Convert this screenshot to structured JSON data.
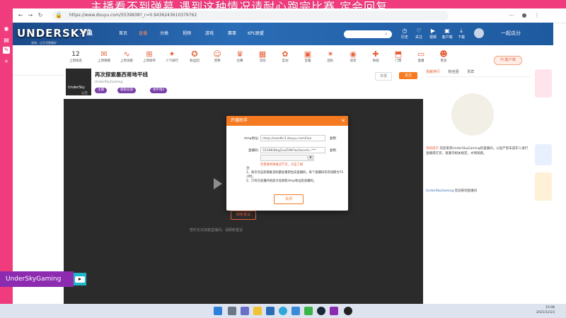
{
  "banner": {
    "text": "主播看不到弹幕  遇到这种情况请耐心跑完比赛 定会回复"
  },
  "browser": {
    "url": "https://www.douyu.com/5539838?_r=0.9436243610379762"
  },
  "overlay": {
    "logo": "UNDERSKY",
    "logo_sub": "游戏，让生活更美好",
    "channel_name": "UnderSkyGaming"
  },
  "site": {
    "logo": "斗鱼",
    "nav": [
      "首页",
      "直播",
      "分类",
      "视频",
      "游戏",
      "赛事",
      "KPL联盟"
    ],
    "search_placeholder": "",
    "header_icons": [
      {
        "icon": "history-icon",
        "label": "历史"
      },
      {
        "icon": "follow-icon",
        "label": "关注"
      },
      {
        "icon": "video-icon",
        "label": "视频"
      },
      {
        "icon": "live-icon",
        "label": "客户端"
      },
      {
        "icon": "download-icon",
        "label": "下载"
      },
      {
        "icon": "user-icon",
        "label": "我的"
      }
    ],
    "banner_right": "一起瓜分"
  },
  "categories": [
    {
      "icon": "level-icon",
      "label": "上周排名",
      "top": "12"
    },
    {
      "icon": "gift-icon",
      "label": "上周捐赠"
    },
    {
      "icon": "wave-icon",
      "label": "上周贡献"
    },
    {
      "icon": "rank-icon",
      "label": "上周榜单"
    },
    {
      "icon": "hot-icon",
      "label": "人气排行"
    },
    {
      "icon": "star-icon",
      "label": "粉丝团"
    },
    {
      "icon": "pet-icon",
      "label": "宠物"
    },
    {
      "icon": "cup-icon",
      "label": "比赛"
    },
    {
      "icon": "calendar-icon",
      "label": "活动"
    },
    {
      "icon": "chat-icon",
      "label": "互动"
    },
    {
      "icon": "box-icon",
      "label": "宝箱"
    },
    {
      "icon": "team-icon",
      "label": "团队"
    },
    {
      "icon": "mic-icon",
      "label": "语音"
    },
    {
      "icon": "shop-icon",
      "label": "商城"
    },
    {
      "icon": "ticket-icon",
      "label": "门票"
    },
    {
      "icon": "tv-icon",
      "label": "直播"
    },
    {
      "icon": "smile-icon",
      "label": "更多"
    }
  ],
  "pc_button": "PC客户端",
  "room": {
    "title": "再次探索墨西哥地平线",
    "streamer": "UnderSkyGaming",
    "avatar_text": "UnderSky",
    "avatar_sub": "公告",
    "tags": [
      "主播",
      "极限竞速",
      "地平线5"
    ],
    "follow_label": "关注",
    "report_label": "举报"
  },
  "video": {
    "message": "暂时无法加载直播间，请刷新重试",
    "button": "刷新重试"
  },
  "modal": {
    "title": "开播助手",
    "rtmp_label": "rtmp地址:",
    "rtmp_value": "rtmp://sendtc3.douyu.com/live",
    "code_label": "直播码:",
    "code_value": "5539838rgZuzZVN?wsSecret=***",
    "copy_label": "复制",
    "select_value": "",
    "warning": "若需要更换推流节点，点击了解",
    "note_title": "注:",
    "notes": [
      "1、每次点击获取推流码都会重新生成直播码，每个直播码仅有效期为72小时。",
      "2、只有在直播开始前才会获取rtmp地址及直播码。"
    ],
    "ok_button": "关闭"
  },
  "right_panel": {
    "tabs": [
      "贡献排行",
      "粉丝团",
      "贵宾"
    ],
    "chat": [
      {
        "user": "系统提示",
        "text": "欢迎来到UnderSkyGaming的直播间，斗鱼严禁未成年人进行直播或打赏，请遵守相关规定，文明观看。"
      },
      {
        "user": "UnderSkyGaming",
        "text": "欢迎来到直播间"
      }
    ]
  },
  "taskbar": {
    "time": "15:08",
    "date": "2021/12/23"
  }
}
